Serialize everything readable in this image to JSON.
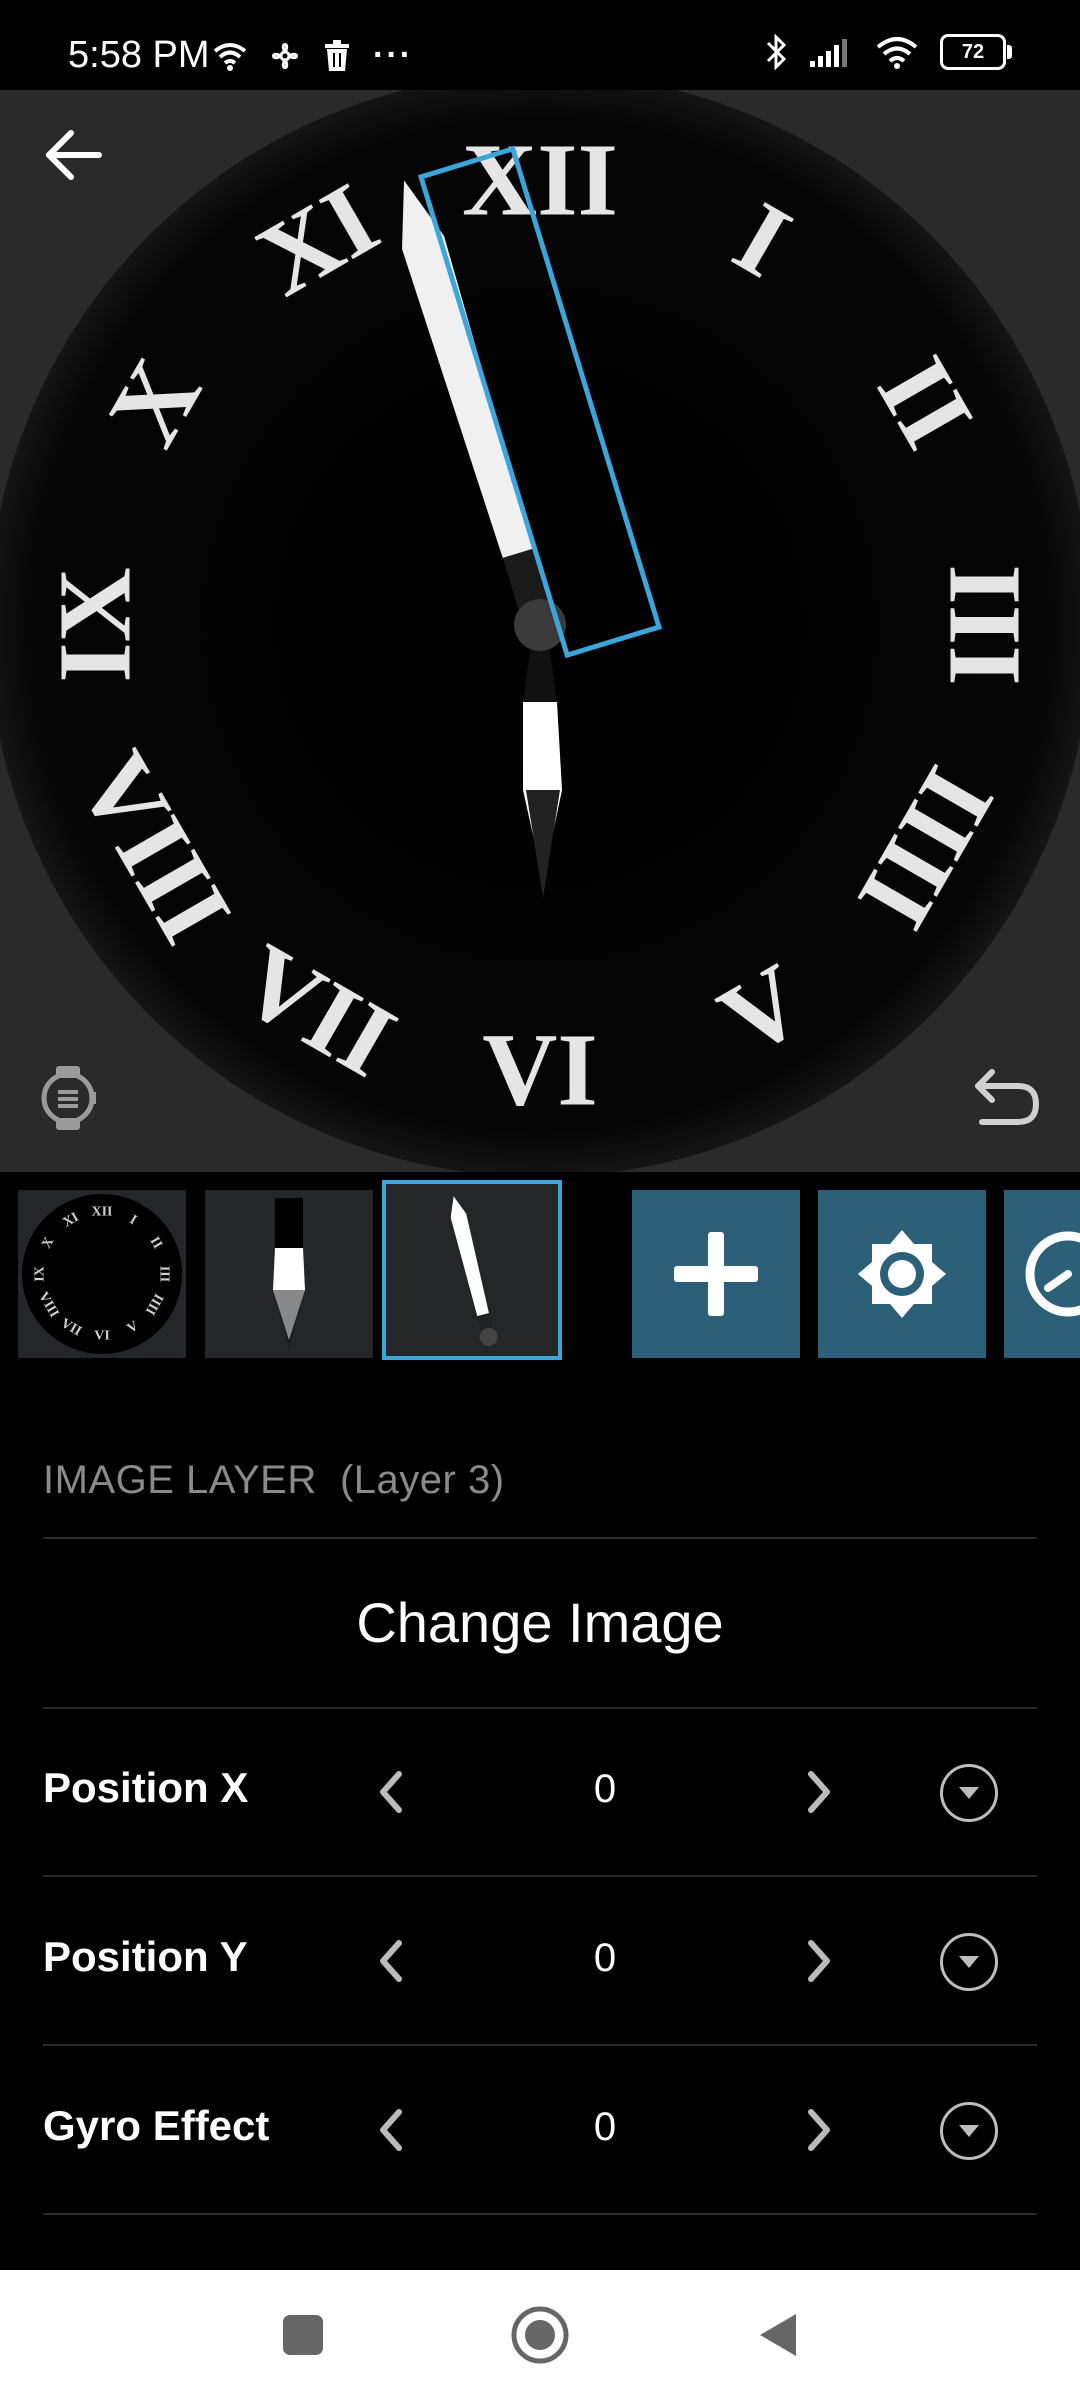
{
  "status_bar": {
    "time": "5:58 PM",
    "battery": "72",
    "more": "···",
    "left_icons": [
      "wifi-icon",
      "fan-icon",
      "trash-icon",
      "more-dots-icon"
    ],
    "right_icons": [
      "bluetooth-icon",
      "signal-icon",
      "wifi-icon",
      "battery-icon"
    ]
  },
  "preview": {
    "numerals": [
      "XII",
      "I",
      "II",
      "III",
      "IIII",
      "V",
      "VI",
      "VII",
      "VIII",
      "IX",
      "X",
      "XI"
    ],
    "icons": [
      "back-arrow-icon",
      "watch-icon",
      "undo-icon"
    ]
  },
  "layers": {
    "thumbnails": [
      "dial-layer-thumb",
      "hour-hand-layer-thumb",
      "minute-hand-layer-thumb"
    ],
    "selected_index": 2,
    "actions": [
      "add-icon",
      "brightness-icon",
      "clock-icon"
    ]
  },
  "panel": {
    "section_title": "IMAGE LAYER  (Layer 3)",
    "change_image": "Change Image",
    "rows": [
      {
        "label": "Position X",
        "value": "0"
      },
      {
        "label": "Position Y",
        "value": "0"
      },
      {
        "label": "Gyro Effect",
        "value": "0"
      }
    ]
  },
  "colors": {
    "accent": "#3ca6da",
    "action_bg": "#2c6078",
    "preview_bg": "#2a2a2a",
    "panel_bg": "#000000"
  },
  "nav": {
    "icons": [
      "recents-icon",
      "home-icon",
      "back-icon"
    ]
  }
}
